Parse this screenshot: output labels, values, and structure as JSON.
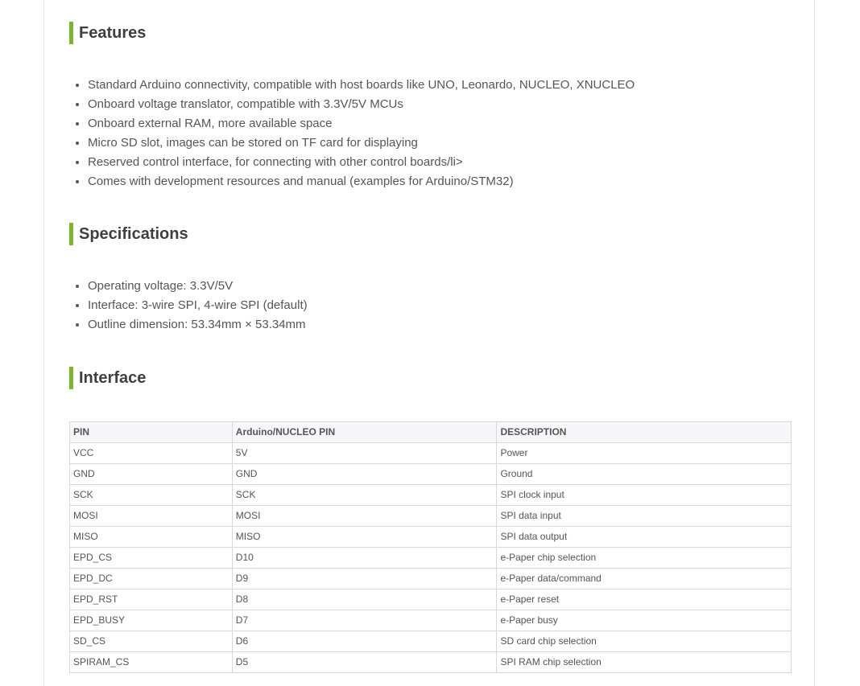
{
  "features": {
    "title": "Features",
    "items": [
      "Standard Arduino connectivity, compatible with host boards like UNO, Leonardo, NUCLEO, XNUCLEO",
      "Onboard voltage translator, compatible with 3.3V/5V MCUs",
      "Onboard external RAM, more available space",
      "Micro SD slot, images can be stored on TF card for displaying",
      "Reserved control interface, for connecting with other control boards/li>",
      "Comes with development resources and manual (examples for Arduino/STM32)"
    ]
  },
  "specifications": {
    "title": "Specifications",
    "items": [
      "Operating voltage: 3.3V/5V",
      "Interface: 3-wire SPI, 4-wire SPI (default)",
      "Outline dimension: 53.34mm × 53.34mm"
    ]
  },
  "interface": {
    "title": "Interface",
    "columns": [
      "PIN",
      "Arduino/NUCLEO PIN",
      "DESCRIPTION"
    ],
    "rows": [
      [
        "VCC",
        "5V",
        "Power"
      ],
      [
        "GND",
        "GND",
        "Ground"
      ],
      [
        "SCK",
        "SCK",
        "SPI clock input"
      ],
      [
        "MOSI",
        "MOSI",
        "SPI data input"
      ],
      [
        "MISO",
        "MISO",
        "SPI data output"
      ],
      [
        "EPD_CS",
        "D10",
        "e-Paper chip selection"
      ],
      [
        "EPD_DC",
        "D9",
        "e-Paper data/command"
      ],
      [
        "EPD_RST",
        "D8",
        "e-Paper reset"
      ],
      [
        "EPD_BUSY",
        "D7",
        "e-Paper busy"
      ],
      [
        "SD_CS",
        "D6",
        "SD card chip selection"
      ],
      [
        "SPIRAM_CS",
        "D5",
        "SPI RAM chip selection"
      ]
    ]
  },
  "colors": {
    "accent_bar": "#7db52f",
    "heading_text": "#3f3f3f",
    "body_text": "#555555",
    "table_border": "#d8d8d8",
    "table_header_bg": "#f7f7fb"
  }
}
